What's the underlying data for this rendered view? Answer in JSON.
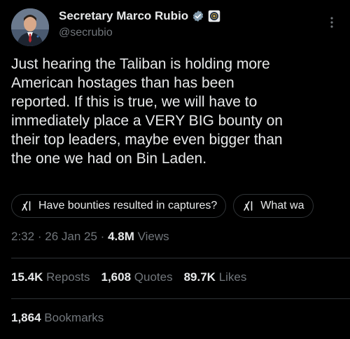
{
  "author": {
    "display_name": "Secretary Marco Rubio",
    "handle": "@secrubio",
    "verified_badge_color": "#829aab",
    "avatar_icon": "person-avatar",
    "affiliation_icon": "government-seal-icon"
  },
  "tweet": {
    "text": "Just hearing the Taliban is holding more\nAmerican hostages than has been\nreported. If this is true, we will have to\nimmediately place a VERY BIG bounty on\ntheir top leaders, maybe even bigger than\nthe one we had on Bin Laden."
  },
  "grok_prompts": [
    {
      "label": "Have bounties resulted in captures?",
      "icon": "grok-icon"
    },
    {
      "label": "What wa",
      "icon": "grok-icon"
    }
  ],
  "meta": {
    "time": "2:32",
    "date": "26 Jan 25",
    "separator": "·",
    "views_count": "4.8M",
    "views_label": "Views"
  },
  "stats": {
    "reposts_count": "15.4K",
    "reposts_label": "Reposts",
    "quotes_count": "1,608",
    "quotes_label": "Quotes",
    "likes_count": "89.7K",
    "likes_label": "Likes",
    "bookmarks_count": "1,864",
    "bookmarks_label": "Bookmarks"
  },
  "colors": {
    "background": "#000000",
    "text_primary": "#e7e9ea",
    "text_secondary": "#71767b",
    "border": "#2f3336"
  }
}
